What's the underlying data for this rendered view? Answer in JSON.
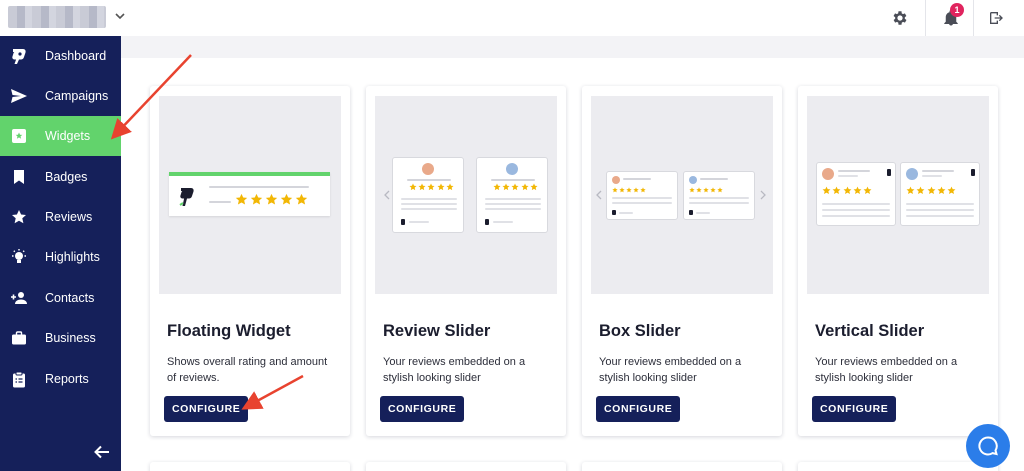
{
  "colors": {
    "sidebar_bg": "#15205a",
    "active_item": "#62d36c",
    "star": "#f2b705",
    "badge": "#e0245e",
    "chat": "#2b7de9",
    "annotation_arrow": "#e8432f"
  },
  "topbar": {
    "account_icon": "chevron-down-icon",
    "settings_icon": "gear-icon",
    "notifications_icon": "bell-icon",
    "notifications_count": "1",
    "logout_icon": "logout-icon"
  },
  "sidebar": {
    "items": [
      {
        "label": "Dashboard",
        "icon": "logo-icon",
        "active": false
      },
      {
        "label": "Campaigns",
        "icon": "send-icon",
        "active": false
      },
      {
        "label": "Widgets",
        "icon": "widget-icon",
        "active": true
      },
      {
        "label": "Badges",
        "icon": "bookmark-icon",
        "active": false
      },
      {
        "label": "Reviews",
        "icon": "star-icon",
        "active": false
      },
      {
        "label": "Highlights",
        "icon": "lightbulb-icon",
        "active": false
      },
      {
        "label": "Contacts",
        "icon": "add-person-icon",
        "active": false
      },
      {
        "label": "Business",
        "icon": "briefcase-icon",
        "active": false
      },
      {
        "label": "Reports",
        "icon": "clipboard-icon",
        "active": false
      }
    ],
    "collapse_icon": "arrow-left-icon"
  },
  "widgets": [
    {
      "title": "Floating Widget",
      "description": "Shows overall rating and amount of reviews.",
      "button": "CONFIGURE",
      "rating_stars": 5
    },
    {
      "title": "Review Slider",
      "description": "Your reviews embedded on a stylish looking slider",
      "button": "CONFIGURE",
      "rating_stars": 5
    },
    {
      "title": "Box Slider",
      "description": "Your reviews embedded on a stylish looking slider",
      "button": "CONFIGURE",
      "rating_stars": 5
    },
    {
      "title": "Vertical Slider",
      "description": "Your reviews embedded on a stylish looking slider",
      "button": "CONFIGURE",
      "rating_stars": 5
    }
  ],
  "chat": {
    "icon": "chat-bubble-icon"
  }
}
